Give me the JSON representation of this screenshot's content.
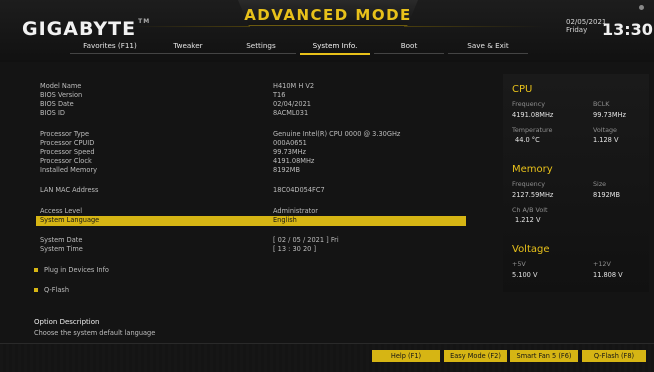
{
  "header": {
    "logo": "GIGABYTE",
    "logo_tm": "TM",
    "mode_title": "ADVANCED MODE",
    "date": "02/05/2021",
    "day": "Friday",
    "time": "13:30"
  },
  "tabs": [
    {
      "label": "Favorites (F11)",
      "active": false
    },
    {
      "label": "Tweaker",
      "active": false
    },
    {
      "label": "Settings",
      "active": false
    },
    {
      "label": "System Info.",
      "active": true
    },
    {
      "label": "Boot",
      "active": false
    },
    {
      "label": "Save & Exit",
      "active": false
    }
  ],
  "system_info": {
    "model_name": {
      "label": "Model Name",
      "value": "H410M H V2"
    },
    "bios_version": {
      "label": "BIOS Version",
      "value": "T16"
    },
    "bios_date": {
      "label": "BIOS Date",
      "value": "02/04/2021"
    },
    "bios_id": {
      "label": "BIOS ID",
      "value": "8ACML031"
    },
    "processor_type": {
      "label": "Processor Type",
      "value": "Genuine Intel(R) CPU 0000 @ 3.30GHz"
    },
    "processor_cpuid": {
      "label": "Processor CPUID",
      "value": "000A0651"
    },
    "processor_speed": {
      "label": "Processor Speed",
      "value": "99.73MHz"
    },
    "processor_clock": {
      "label": "Processor Clock",
      "value": "4191.08MHz"
    },
    "installed_memory": {
      "label": "Installed Memory",
      "value": "8192MB"
    },
    "lan_mac": {
      "label": "LAN MAC Address",
      "value": "18C04D054FC7"
    },
    "access_level": {
      "label": "Access Level",
      "value": "Administrator"
    },
    "system_language": {
      "label": "System Language",
      "value": "English"
    },
    "system_date": {
      "label": "System Date",
      "value": "[ 02 / 05 / 2021 ] Fri"
    },
    "system_time": {
      "label": "System Time",
      "value": "[ 13 : 30 20 ]"
    },
    "plug_in_devices": "Plug in Devices Info",
    "qflash": "Q-Flash"
  },
  "description": {
    "title": "Option Description",
    "text": "Choose the system default language"
  },
  "monitor": {
    "cpu": {
      "title": "CPU",
      "frequency_label": "Frequency",
      "frequency": "4191.08MHz",
      "bclk_label": "BCLK",
      "bclk": "99.73MHz",
      "temperature_label": "Temperature",
      "temperature": "44.0 °C",
      "voltage_label": "Voltage",
      "voltage": "1.128 V"
    },
    "memory": {
      "title": "Memory",
      "frequency_label": "Frequency",
      "frequency": "2127.59MHz",
      "size_label": "Size",
      "size": "8192MB",
      "chab_label": "Ch A/B Volt",
      "chab": "1.212 V"
    },
    "voltage": {
      "title": "Voltage",
      "p5_label": "+5V",
      "p5": "5.100 V",
      "p12_label": "+12V",
      "p12": "11.808 V"
    }
  },
  "buttons": {
    "help": "Help (F1)",
    "easy_mode": "Easy Mode (F2)",
    "smart_fan": "Smart Fan 5 (F6)",
    "qflash": "Q-Flash (F8)"
  },
  "colors": {
    "accent": "#e8c11a",
    "selection": "#d6b514",
    "background": "#141414"
  }
}
